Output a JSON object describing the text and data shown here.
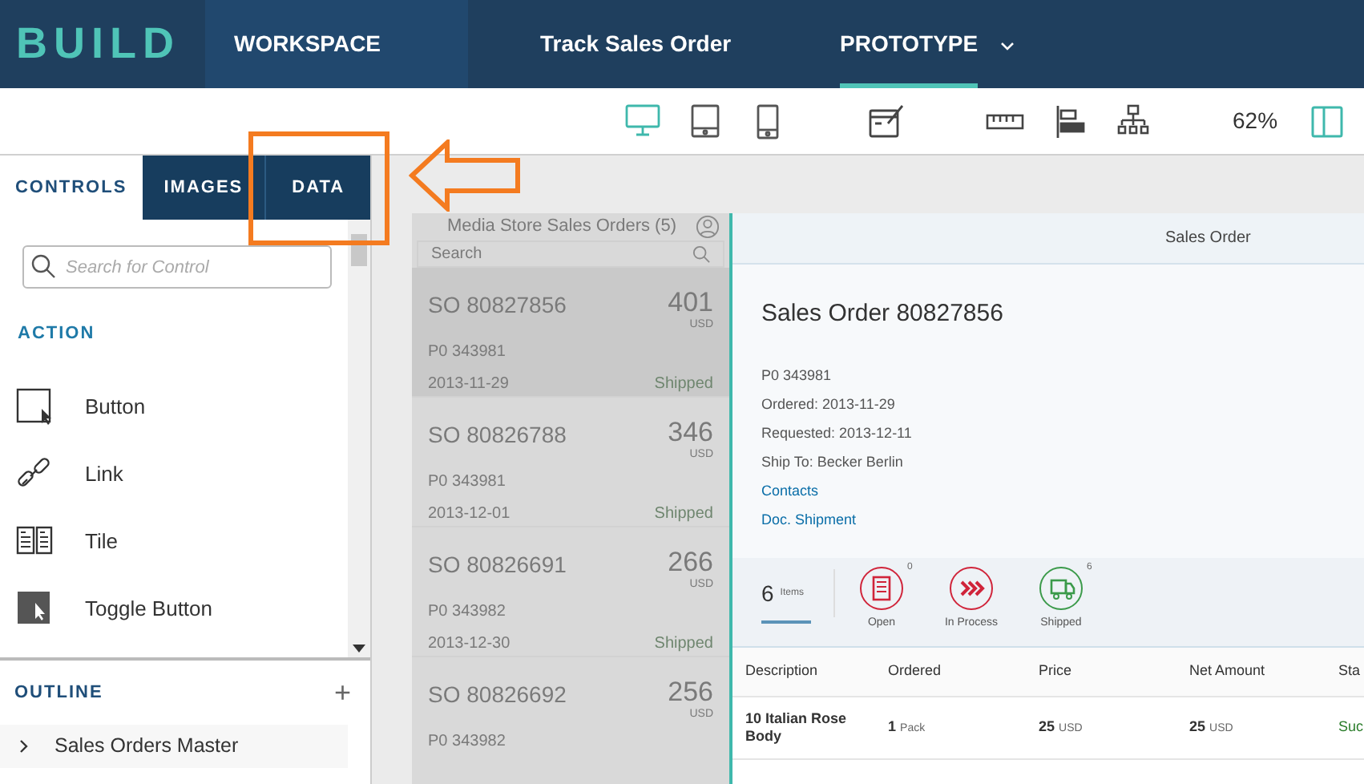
{
  "header": {
    "logo": "BUILD",
    "breadcrumbs": [
      {
        "label": "WORKSPACE",
        "selected": false
      },
      {
        "label": "Track Sales Order",
        "selected": false
      },
      {
        "label": "PROTOTYPE",
        "selected": true
      }
    ]
  },
  "toolbar": {
    "devices": [
      {
        "kind": "desktop",
        "selected": true
      },
      {
        "kind": "tablet",
        "selected": false
      },
      {
        "kind": "phone",
        "selected": false
      }
    ],
    "zoom": "62%"
  },
  "left_panel": {
    "tabs": [
      {
        "label": "CONTROLS",
        "selected": true
      },
      {
        "label": "IMAGES",
        "selected": false
      },
      {
        "label": "DATA",
        "selected": false
      }
    ],
    "search": {
      "placeholder": "Search for Control"
    },
    "section": "ACTION",
    "controls": [
      {
        "kind": "button",
        "label": "Button"
      },
      {
        "kind": "link",
        "label": "Link"
      },
      {
        "kind": "tile",
        "label": "Tile"
      },
      {
        "kind": "toggle",
        "label": "Toggle Button"
      }
    ],
    "outline": {
      "title": "OUTLINE",
      "add": "+",
      "items": [
        {
          "label": "Sales Orders Master",
          "expanded": false
        }
      ]
    }
  },
  "master": {
    "title": "Media Store Sales Orders (5)",
    "search_placeholder": "Search",
    "orders": [
      {
        "id": "SO 80827856",
        "amount": "401",
        "currency": "USD",
        "po": "P0 343981",
        "date": "2013-11-29",
        "status": "Shipped",
        "selected": true
      },
      {
        "id": "SO 80826788",
        "amount": "346",
        "currency": "USD",
        "po": "P0 343981",
        "date": "2013-12-01",
        "status": "Shipped",
        "selected": false
      },
      {
        "id": "SO 80826691",
        "amount": "266",
        "currency": "USD",
        "po": "P0 343982",
        "date": "2013-12-30",
        "status": "Shipped",
        "selected": false
      },
      {
        "id": "SO 80826692",
        "amount": "256",
        "currency": "USD",
        "po": "P0 343982",
        "selected": false
      }
    ]
  },
  "detail": {
    "page_title": "Sales Order",
    "title": "Sales Order 80827856",
    "attributes": [
      "P0 343981",
      "Ordered: 2013-11-29",
      "Requested: 2013-12-11",
      "Ship To: Becker Berlin"
    ],
    "links": [
      "Contacts",
      "Doc. Shipment"
    ],
    "count_tab": {
      "count": "6",
      "label": "Items",
      "selected": true
    },
    "status_tabs": [
      {
        "kind": "open",
        "label": "Open",
        "count": "0",
        "color": "#d0243a"
      },
      {
        "kind": "process",
        "label": "In Process",
        "color": "#d0243a"
      },
      {
        "kind": "shipped",
        "label": "Shipped",
        "count": "6",
        "color": "#3b9a4a"
      }
    ],
    "table": {
      "columns": [
        "Description",
        "Ordered",
        "Price",
        "Net Amount",
        "Sta"
      ],
      "rows": [
        [
          {
            "value": "10 Italian Rose Body"
          },
          {
            "value": "1",
            "unit": "Pack"
          },
          {
            "value": "25",
            "unit": "USD"
          },
          {
            "value": "25",
            "unit": "USD"
          },
          {
            "value": "Suc"
          }
        ]
      ]
    }
  }
}
